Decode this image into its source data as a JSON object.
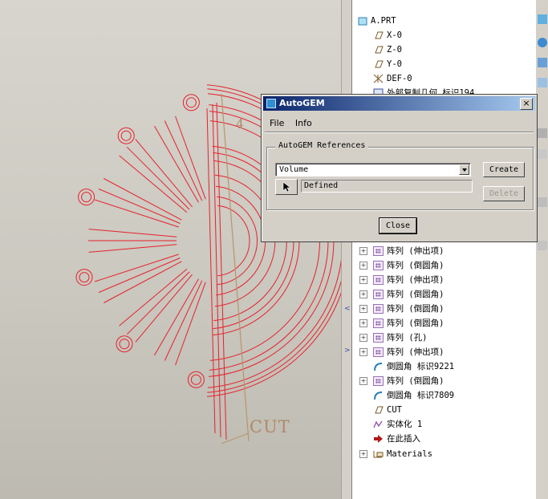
{
  "viewport": {
    "label_number": "4",
    "label_cut": "CUT",
    "model_color": "#e8202c"
  },
  "model_tree": {
    "items": [
      {
        "text": "A.PRT",
        "icon": "part-icon",
        "expander": false
      },
      {
        "text": "X-0",
        "icon": "datum-plane-icon",
        "expander": false
      },
      {
        "text": "Z-0",
        "icon": "datum-plane-icon",
        "expander": false
      },
      {
        "text": "Y-0",
        "icon": "datum-plane-icon",
        "expander": false
      },
      {
        "text": "DEF-0",
        "icon": "coordinate-system-icon",
        "expander": false
      },
      {
        "text": "外部复制几何 标识194",
        "icon": "copy-geometry-icon",
        "expander": false
      },
      {
        "text": "阵列 (伸出项)",
        "icon": "pattern-icon",
        "expander": true
      },
      {
        "text": "阵列 (倒圆角)",
        "icon": "pattern-icon",
        "expander": true
      },
      {
        "text": "阵列 (伸出项)",
        "icon": "pattern-icon",
        "expander": true
      },
      {
        "text": "阵列 (倒圆角)",
        "icon": "pattern-icon",
        "expander": true
      },
      {
        "text": "阵列 (倒圆角)",
        "icon": "pattern-icon",
        "expander": true
      },
      {
        "text": "阵列 (倒圆角)",
        "icon": "pattern-icon",
        "expander": true
      },
      {
        "text": "阵列 (孔)",
        "icon": "pattern-icon",
        "expander": true
      },
      {
        "text": "阵列 (伸出项)",
        "icon": "pattern-icon",
        "expander": true
      },
      {
        "text": "倒圆角 标识9221",
        "icon": "round-icon",
        "expander": false
      },
      {
        "text": "阵列 (倒圆角)",
        "icon": "pattern-icon",
        "expander": true
      },
      {
        "text": "倒圆角 标识7809",
        "icon": "round-icon",
        "expander": false
      },
      {
        "text": "CUT",
        "icon": "datum-plane-icon",
        "expander": false
      },
      {
        "text": "实体化 1",
        "icon": "solidify-icon",
        "expander": false
      },
      {
        "text": "在此插入",
        "icon": "insert-here-arrow-icon",
        "expander": false
      },
      {
        "text": "Materials",
        "icon": "materials-icon",
        "expander": true
      }
    ]
  },
  "dialog": {
    "title": "AutoGEM",
    "close_glyph": "×",
    "menu": {
      "file": "File",
      "info": "Info"
    },
    "group_label": "AutoGEM References",
    "select_value": "Volume",
    "create_label": "Create",
    "delete_label": "Delete",
    "status_value": "Defined",
    "close_label": "Close"
  }
}
